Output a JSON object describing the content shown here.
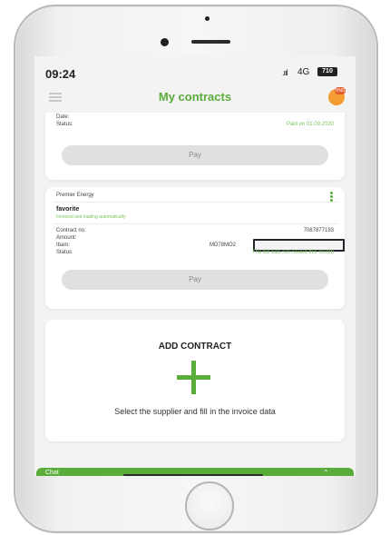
{
  "status_bar": {
    "time": "09:24",
    "signal": ".ııl",
    "network": "4G",
    "battery": "710"
  },
  "header": {
    "title": "My contracts",
    "avatar_badge": "HNS"
  },
  "contract_top": {
    "rows": [
      {
        "label": "Date:",
        "value": ""
      },
      {
        "label": "Status:",
        "value": "Paid on 01.09.2020"
      }
    ],
    "pay_label": "Pay"
  },
  "contract": {
    "supplier": "Premier Energy",
    "favorite_title": "favorite",
    "favorite_subtitle": "Invoiced and loading automatically",
    "rows": [
      {
        "label": "Contract no:",
        "value": "7087877193"
      },
      {
        "label": "Amount:",
        "value": ""
      },
      {
        "label": "Ibam:",
        "value": "MD78MO2"
      },
      {
        "label": "Status:",
        "value": "The bill was not issued this month"
      }
    ],
    "pay_label": "Pay"
  },
  "add_contract": {
    "title": "ADD CONTRACT",
    "description": "Select the supplier and fill in the invoice data"
  },
  "chat": {
    "label": "Chat"
  },
  "colors": {
    "accent": "#5aad3a",
    "light_green": "#7cc15c",
    "pay_bg": "#e0e0e0"
  }
}
